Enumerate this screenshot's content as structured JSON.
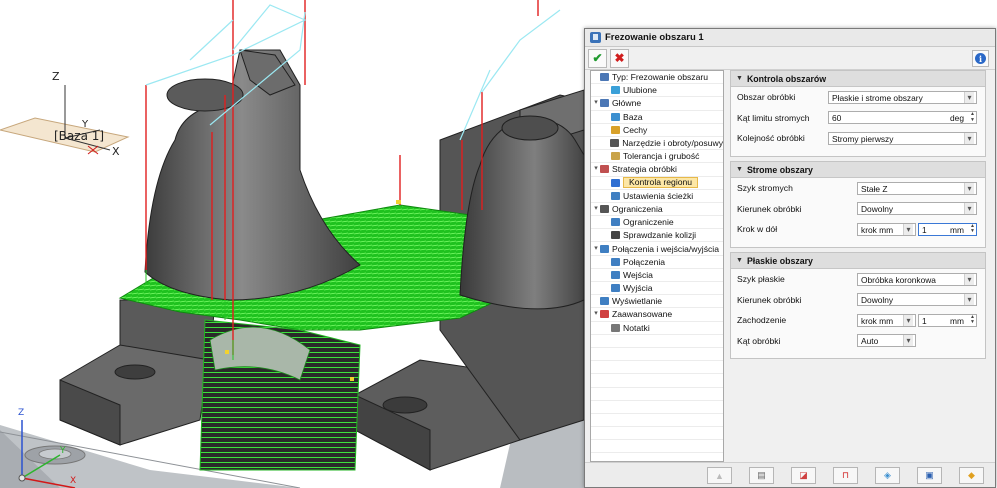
{
  "dialog": {
    "title": "Frezowanie obszaru 1"
  },
  "viewport": {
    "base_label": "[Baza 1]",
    "axis_labels": {
      "z": "Z",
      "y": "Y",
      "x": "X"
    },
    "colors": {
      "part": "#5a5a5a",
      "toolpath": "#2fd82f",
      "lead": "#e21e1e",
      "link": "#9be8f2",
      "background": "#ffffff"
    }
  },
  "tree": [
    {
      "label": "Typ: Frezowanie obszaru",
      "level": 0,
      "toggle": "",
      "icon": "type-icon",
      "color": "#4b77b5"
    },
    {
      "label": "Ulubione",
      "level": 1,
      "toggle": "",
      "icon": "star-icon",
      "color": "#3aa0d8"
    },
    {
      "label": "Główne",
      "level": 0,
      "toggle": "▾",
      "icon": "main-icon",
      "color": "#4b77b5"
    },
    {
      "label": "Baza",
      "level": 1,
      "toggle": "",
      "icon": "base-icon",
      "color": "#3b8fd0"
    },
    {
      "label": "Cechy",
      "level": 1,
      "toggle": "",
      "icon": "features-icon",
      "color": "#d8a12a"
    },
    {
      "label": "Narzędzie i obroty/posuwy",
      "level": 1,
      "toggle": "",
      "icon": "tool-icon",
      "color": "#555555"
    },
    {
      "label": "Tolerancja i grubość",
      "level": 1,
      "toggle": "",
      "icon": "tolerance-icon",
      "color": "#c9a349"
    },
    {
      "label": "Strategia obróbki",
      "level": 0,
      "toggle": "▾",
      "icon": "strategy-icon",
      "color": "#c05050"
    },
    {
      "label": "Kontrola regionu",
      "level": 1,
      "toggle": "",
      "icon": "region-icon",
      "color": "#2f6fd2",
      "selected": true
    },
    {
      "label": "Ustawienia ścieżki",
      "level": 1,
      "toggle": "",
      "icon": "path-settings-icon",
      "color": "#3f7fc2"
    },
    {
      "label": "Ograniczenia",
      "level": 0,
      "toggle": "▾",
      "icon": "limits-icon",
      "color": "#555555"
    },
    {
      "label": "Ograniczenie",
      "level": 1,
      "toggle": "",
      "icon": "limit-icon",
      "color": "#3f7fc2"
    },
    {
      "label": "Sprawdzanie kolizji",
      "level": 1,
      "toggle": "",
      "icon": "collision-icon",
      "color": "#444444"
    },
    {
      "label": "Połączenia i wejścia/wyjścia",
      "level": 0,
      "toggle": "▾",
      "icon": "links-icon",
      "color": "#3f7fc2"
    },
    {
      "label": "Połączenia",
      "level": 1,
      "toggle": "",
      "icon": "link-icon",
      "color": "#3f7fc2"
    },
    {
      "label": "Wejścia",
      "level": 1,
      "toggle": "",
      "icon": "entry-icon",
      "color": "#3f7fc2"
    },
    {
      "label": "Wyjścia",
      "level": 1,
      "toggle": "",
      "icon": "exit-icon",
      "color": "#3f7fc2"
    },
    {
      "label": "Wyświetlanie",
      "level": 0,
      "toggle": "",
      "icon": "display-icon",
      "color": "#3f7fc2"
    },
    {
      "label": "Zaawansowane",
      "level": 0,
      "toggle": "▾",
      "icon": "advanced-icon",
      "color": "#d04040"
    },
    {
      "label": "Notatki",
      "level": 1,
      "toggle": "",
      "icon": "notes-icon",
      "color": "#777777"
    }
  ],
  "sections": {
    "control": {
      "title": "Kontrola obszarów",
      "fields": {
        "machining_area": {
          "label": "Obszar obróbki",
          "value": "Płaskie i strome obszary"
        },
        "steep_angle": {
          "label": "Kąt limitu stromych",
          "value": "60",
          "unit": "deg"
        },
        "order": {
          "label": "Kolejność obróbki",
          "value": "Stromy pierwszy"
        }
      }
    },
    "steep": {
      "title": "Strome obszary",
      "fields": {
        "pattern": {
          "label": "Szyk stromych",
          "value": "Stałe Z"
        },
        "direction": {
          "label": "Kierunek obróbki",
          "value": "Dowolny"
        },
        "stepdown": {
          "label": "Krok w dół",
          "mode": "krok mm",
          "value": "1",
          "unit": "mm"
        }
      }
    },
    "flat": {
      "title": "Płaskie obszary",
      "fields": {
        "pattern": {
          "label": "Szyk płaskie",
          "value": "Obróbka koronkowa"
        },
        "direction": {
          "label": "Kierunek obróbki",
          "value": "Dowolny"
        },
        "overlap": {
          "label": "Zachodzenie",
          "mode": "krok mm",
          "value": "1",
          "unit": "mm"
        },
        "angle": {
          "label": "Kąt obróbki",
          "value": "Auto"
        }
      }
    }
  }
}
